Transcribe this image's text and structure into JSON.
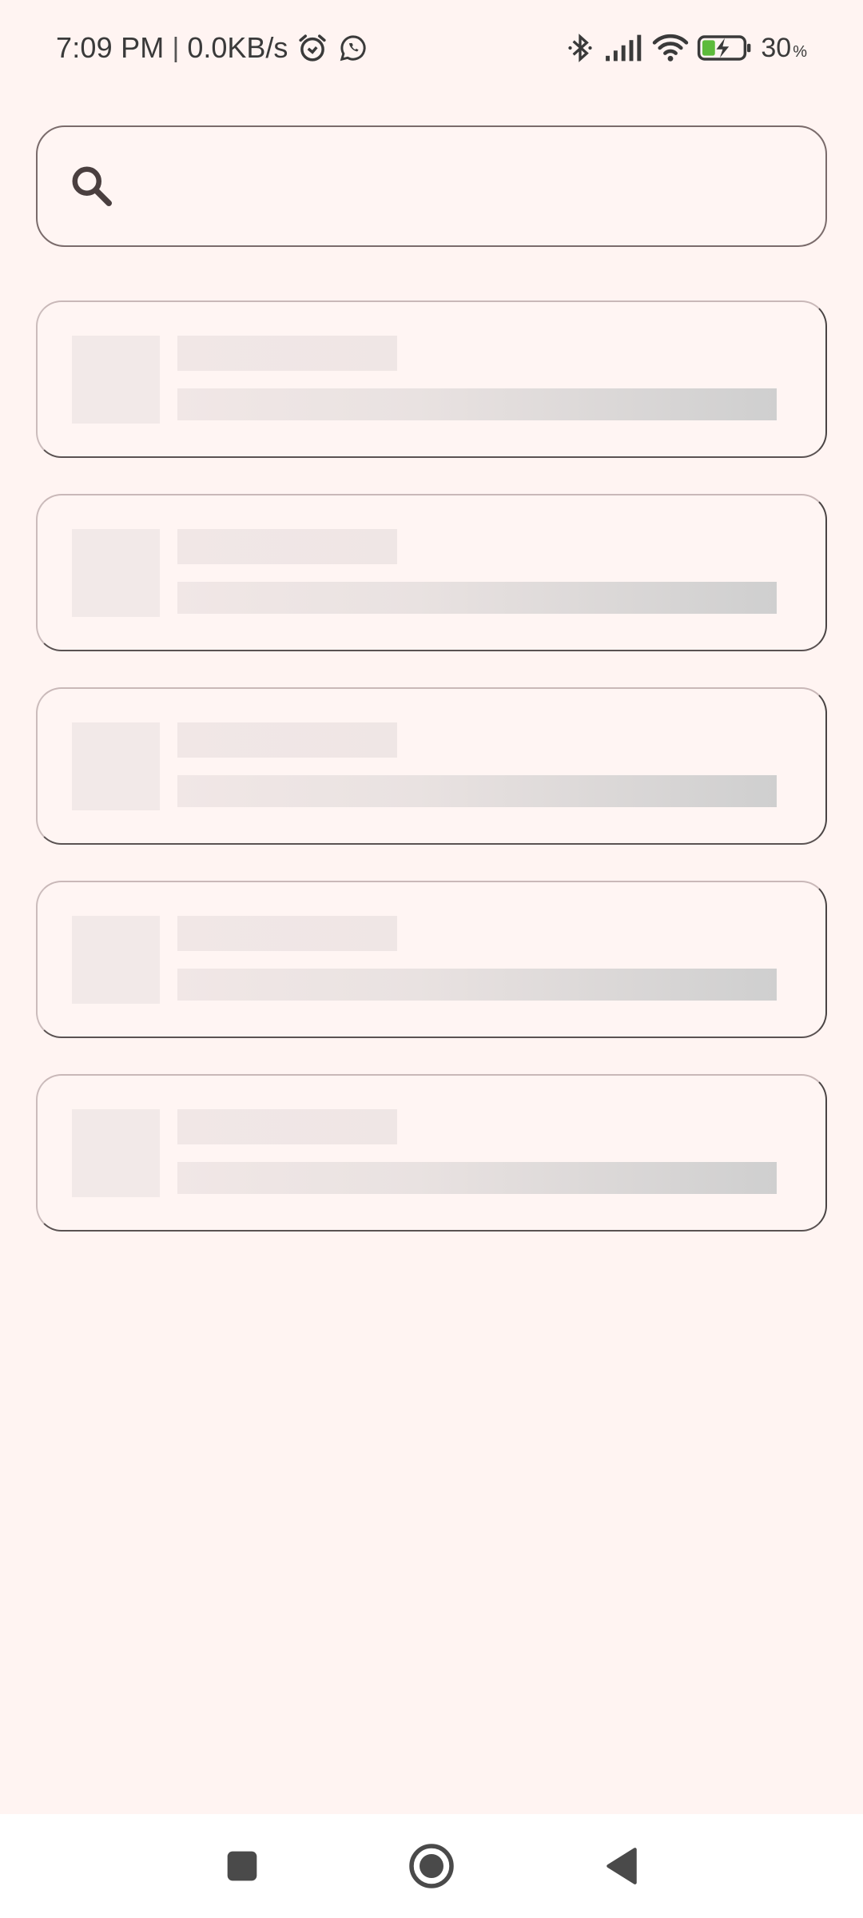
{
  "status_bar": {
    "time": "7:09 PM",
    "separator": "|",
    "net_speed": "0.0KB/s",
    "battery_percent": "30",
    "battery_unit": "%",
    "icons": [
      "alarm-icon",
      "whatsapp-icon",
      "bluetooth-icon",
      "signal-icon",
      "wifi-icon",
      "battery-charging-icon"
    ]
  },
  "search": {
    "value": "",
    "placeholder": "",
    "icon": "search-icon"
  },
  "list": {
    "state": "loading",
    "skeleton_count": 5
  },
  "nav_bar": {
    "buttons": [
      "recents-button",
      "home-button",
      "back-button"
    ]
  },
  "colors": {
    "background": "#FFF4F2",
    "battery_fill": "#5DBB3C",
    "text": "#3a3a3a"
  }
}
